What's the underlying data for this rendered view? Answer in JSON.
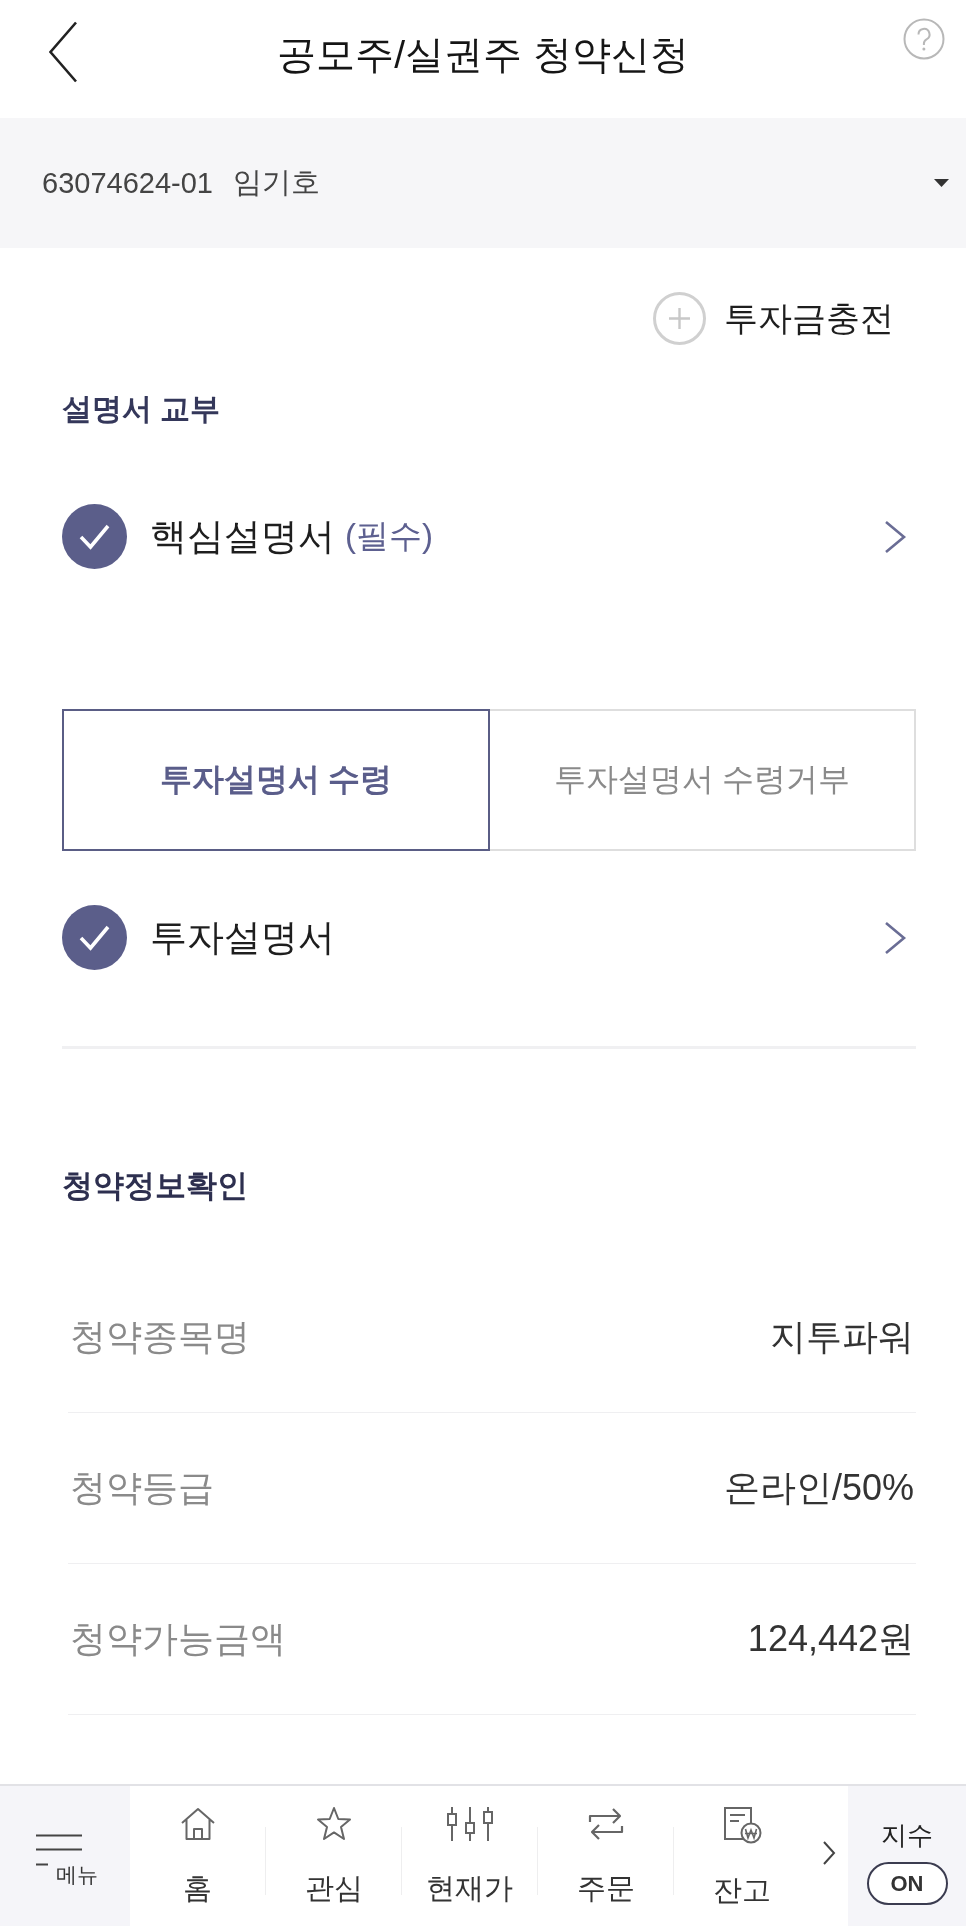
{
  "header": {
    "title": "공모주/실권주 청약신청"
  },
  "account": {
    "number": "63074624-01",
    "name": "임기호"
  },
  "charge_button": {
    "label": "투자금충전"
  },
  "prospectus": {
    "title": "설명서 교부",
    "core_items": [
      {
        "label": "핵심설명서",
        "note": "(필수)",
        "checked": true
      }
    ],
    "tabs": [
      {
        "label": "투자설명서 수령",
        "selected": true
      },
      {
        "label": "투자설명서 수령거부",
        "selected": false
      }
    ],
    "items": [
      {
        "label": "투자설명서",
        "checked": true
      }
    ]
  },
  "subscription_info": {
    "title": "청약정보확인",
    "rows": [
      {
        "label": "청약종목명",
        "value": "지투파워"
      },
      {
        "label": "청약등급",
        "value": "온라인/50%"
      },
      {
        "label": "청약가능금액",
        "value": "124,442원"
      }
    ]
  },
  "bottom_nav": {
    "menu_label": "메뉴",
    "items": [
      {
        "label": "홈"
      },
      {
        "label": "관심"
      },
      {
        "label": "현재가"
      },
      {
        "label": "주문"
      },
      {
        "label": "잔고"
      }
    ],
    "index": {
      "label": "지수",
      "toggle": "ON"
    }
  }
}
